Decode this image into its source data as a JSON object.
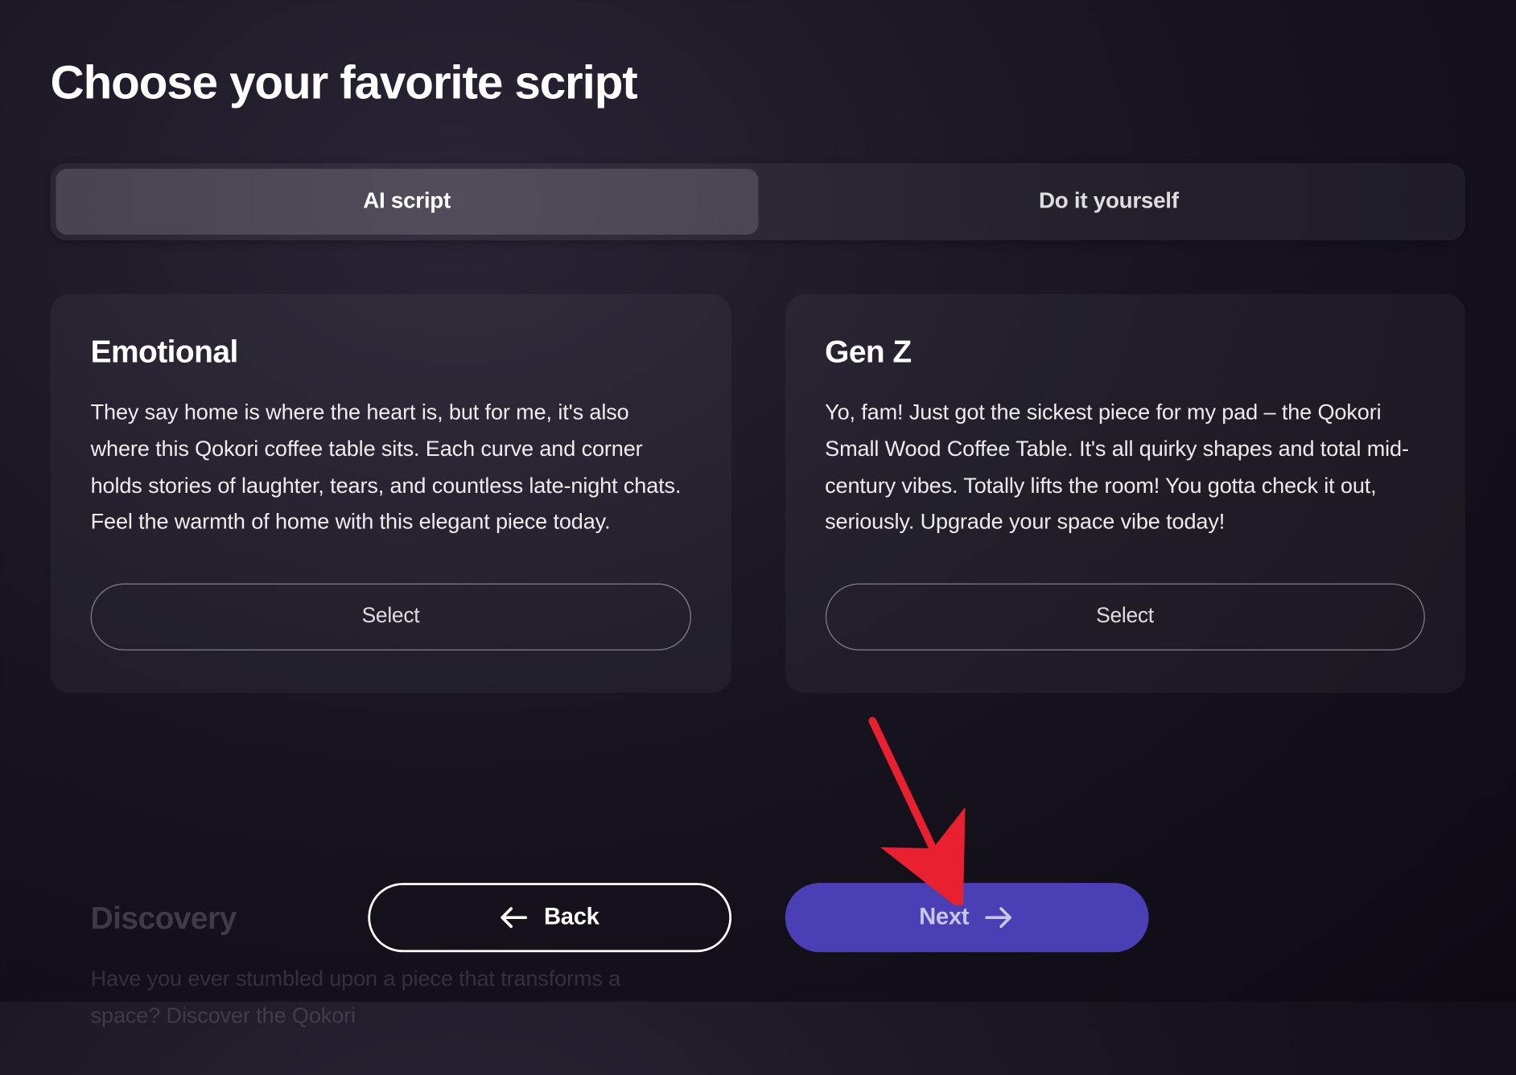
{
  "page_title": "Choose your favorite script",
  "tabs": [
    {
      "label": "AI script",
      "active": true
    },
    {
      "label": "Do it yourself",
      "active": false
    }
  ],
  "cards": [
    {
      "title": "Emotional",
      "body": "They say home is where the heart is, but for me, it's also where this Qokori coffee table sits. Each curve and corner holds stories of laughter, tears, and countless late-night chats. Feel the warmth of home with this elegant piece today.",
      "select_label": "Select"
    },
    {
      "title": "Gen Z",
      "body": "Yo, fam! Just got the sickest piece for my pad – the Qokori Small Wood Coffee Table. It's all quirky shapes and total mid-century vibes. Totally lifts the room! You gotta check it out, seriously. Upgrade your space vibe today!",
      "select_label": "Select"
    }
  ],
  "faded_card": {
    "title": "Discovery",
    "body": "Have you ever stumbled upon a piece that transforms a space? Discover the Qokori"
  },
  "footer": {
    "back_label": "Back",
    "next_label": "Next"
  },
  "colors": {
    "accent": "#4b3fb5",
    "annotation_arrow": "#e9202f"
  }
}
